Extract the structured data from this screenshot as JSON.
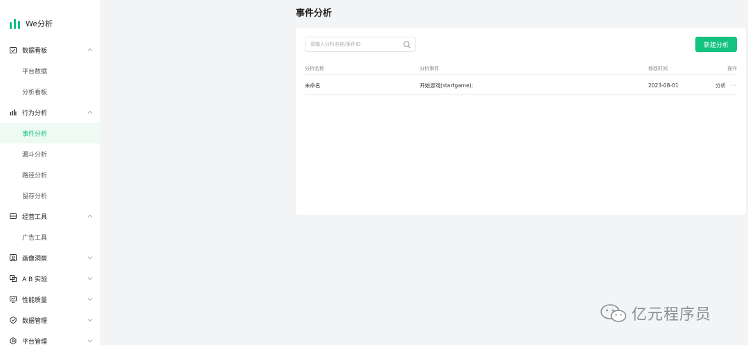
{
  "app": {
    "name": "We分析"
  },
  "sidebar": {
    "groups": [
      {
        "label": "数据看板",
        "icon": "dashboard-icon",
        "expanded": true,
        "items": [
          "平台数据",
          "分析看板"
        ]
      },
      {
        "label": "行为分析",
        "icon": "bar-chart-icon",
        "expanded": true,
        "items": [
          "事件分析",
          "漏斗分析",
          "路径分析",
          "留存分析"
        ]
      },
      {
        "label": "经营工具",
        "icon": "wallet-icon",
        "expanded": true,
        "items": [
          "广告工具"
        ]
      },
      {
        "label": "画像洞察",
        "icon": "portrait-icon",
        "expanded": false,
        "items": []
      },
      {
        "label": "A B 实验",
        "icon": "ab-test-icon",
        "expanded": false,
        "items": []
      },
      {
        "label": "性能质量",
        "icon": "monitor-icon",
        "expanded": false,
        "items": []
      },
      {
        "label": "数据管理",
        "icon": "shield-icon",
        "expanded": false,
        "items": []
      },
      {
        "label": "平台管理",
        "icon": "settings-icon",
        "expanded": false,
        "items": []
      }
    ],
    "active_item": "事件分析"
  },
  "page": {
    "title": "事件分析"
  },
  "toolbar": {
    "search_placeholder": "请输入分析名称/事件ID",
    "search_value": "",
    "new_button_label": "新建分析"
  },
  "table": {
    "columns": [
      "分析名称",
      "分析事件",
      "修改时间",
      "操作"
    ],
    "rows": [
      {
        "name": "未命名",
        "event": "开始游戏(startgame);",
        "modified": "2023-08-01",
        "action": "分析",
        "more": "···"
      }
    ]
  },
  "watermark": {
    "text": "亿元程序员"
  },
  "colors": {
    "accent": "#13c27e",
    "active_bg": "#eefaf4",
    "page_bg": "#f3f4f6"
  }
}
